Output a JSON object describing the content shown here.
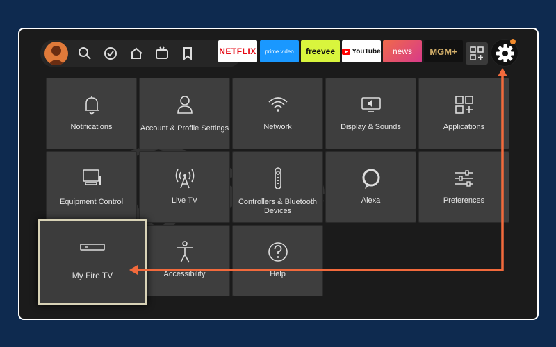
{
  "nav": {
    "icons": [
      "profile-avatar",
      "search-icon",
      "check-circle-icon",
      "home-icon",
      "tv-icon",
      "bookmark-icon"
    ],
    "apps": [
      {
        "name": "NETFLIX",
        "bg": "#ffffff",
        "fg": "#e50914"
      },
      {
        "name": "prime video",
        "bg": "#1a98ff",
        "fg": "#ffffff"
      },
      {
        "name": "freevee",
        "bg": "#d9f53d",
        "fg": "#111111"
      },
      {
        "name": "YouTube",
        "bg": "#ffffff",
        "fg": "#111111"
      },
      {
        "name": "news",
        "bg": "#e8505b",
        "fg": "#ffffff"
      },
      {
        "name": "MGM+",
        "bg": "#111111",
        "fg": "#d4b06a"
      }
    ],
    "apps_grid_icon": "apps-grid-icon",
    "settings_icon": "gear-icon"
  },
  "tiles": [
    {
      "label": "Notifications",
      "icon": "bell-icon"
    },
    {
      "label": "Account & Profile Settings",
      "icon": "person-icon"
    },
    {
      "label": "Network",
      "icon": "wifi-icon"
    },
    {
      "label": "Display & Sounds",
      "icon": "display-sound-icon"
    },
    {
      "label": "Applications",
      "icon": "apps-icon"
    },
    {
      "label": "Equipment Control",
      "icon": "tv-desktop-icon"
    },
    {
      "label": "Live TV",
      "icon": "antenna-icon"
    },
    {
      "label": "Controllers & Bluetooth Devices",
      "icon": "remote-icon"
    },
    {
      "label": "Alexa",
      "icon": "alexa-icon"
    },
    {
      "label": "Preferences",
      "icon": "sliders-icon"
    },
    {
      "label": "My Fire TV",
      "icon": "fire-tv-device-icon"
    },
    {
      "label": "Accessibility",
      "icon": "accessibility-icon"
    },
    {
      "label": "Help",
      "icon": "help-icon"
    }
  ],
  "watermark": "Safelyo",
  "colors": {
    "page_bg": "#0e2a4f",
    "screen_bg": "#1b1b1b",
    "tile_bg": "#3e3e3e",
    "arrow": "#f26a3c",
    "focus_border": "#d8d2b6"
  }
}
